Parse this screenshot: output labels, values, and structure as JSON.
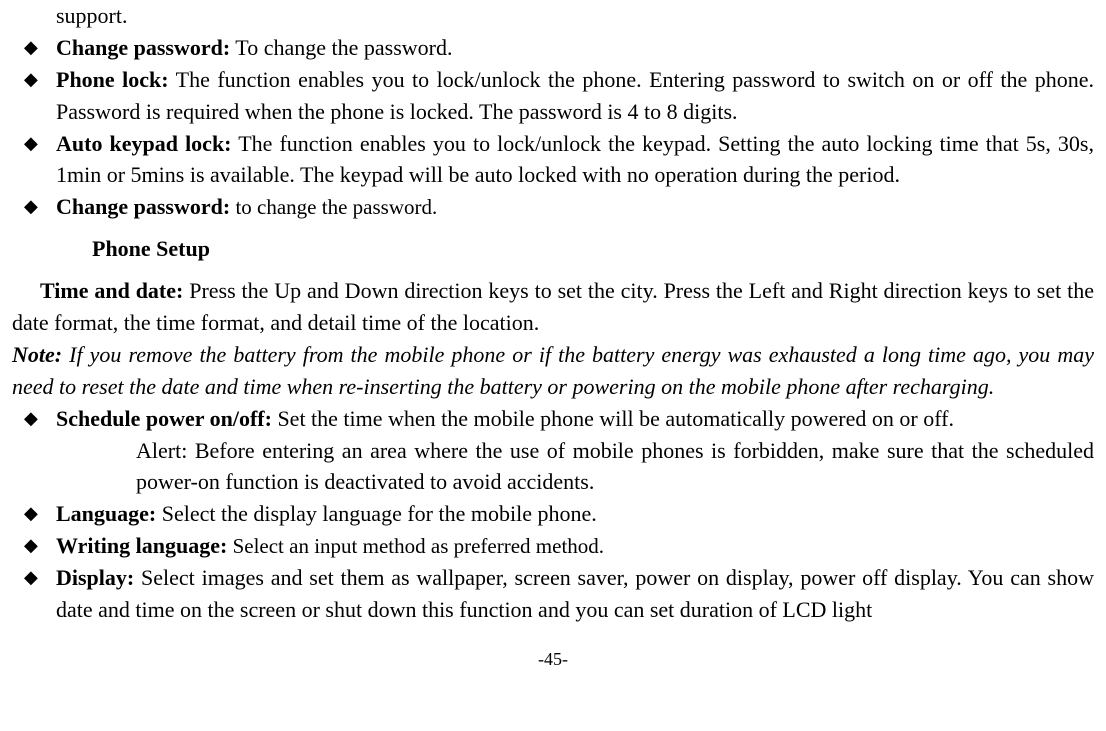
{
  "top_fragment": "support.",
  "bullets_a": [
    {
      "label": "Change password:",
      "text": " To change the password."
    },
    {
      "label": "Phone lock:",
      "text": " The function enables you to lock/unlock the phone. Entering password to switch on or off the phone. Password is required when the phone is locked. The password is 4 to 8 digits."
    },
    {
      "label": "Auto keypad lock:",
      "text": " The function enables you to lock/unlock the keypad. Setting the auto locking time that 5s, 30s, 1min or 5mins is available. The keypad will be auto locked with no operation during the period."
    },
    {
      "label": "Change password:",
      "text": " to change the password.",
      "text_small": true
    }
  ],
  "heading": "Phone Setup",
  "time_date_label": "Time and date: ",
  "time_date_text": "Press the Up and Down direction keys to set the city. Press the Left and Right direction keys to set the date format, the time format, and detail time of the location.",
  "note_label": "Note:",
  "note_text": " If you remove the battery from the mobile phone or if the battery energy was exhausted a long time ago, you may need to reset the date and time when re-inserting the battery or powering on the mobile phone after recharging.",
  "bullets_b": [
    {
      "label": "Schedule power on/off:",
      "text": " Set the time when the mobile phone will be automatically powered on or off.",
      "sub": "Alert: Before entering an area where the use of mobile phones is forbidden, make sure that the scheduled power-on function is deactivated to avoid accidents."
    },
    {
      "label": "Language:",
      "text": " Select the display language for the mobile phone."
    },
    {
      "label": "Writing language:",
      "text": " Select an input method as preferred method.",
      "text_small": true
    },
    {
      "label": "Display:",
      "text": " Select images and set them as wallpaper, screen saver, power on display, power off display. You can show date and time on the screen or shut down this function and you can set duration of LCD light"
    }
  ],
  "page_number": "-45-"
}
